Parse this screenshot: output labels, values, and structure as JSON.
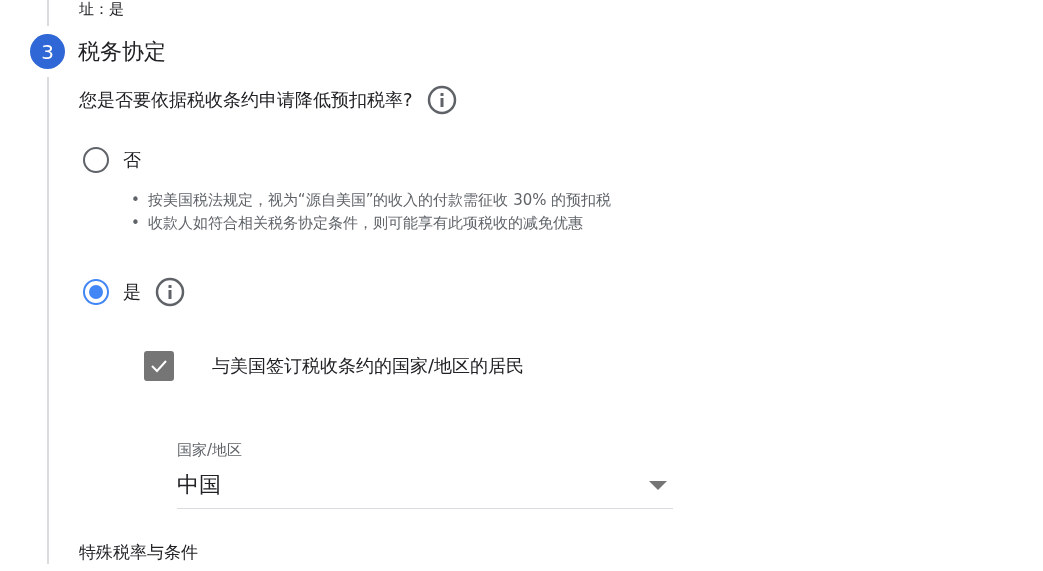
{
  "previous_answer": "址：是",
  "step": {
    "number": "3",
    "title": "税务协定"
  },
  "question": "您是否要依据税收条约申请降低预扣税率?",
  "options": [
    {
      "label": "否",
      "selected": false,
      "info": false,
      "notes": [
        {
          "bullet": "•",
          "text": "按美国税法规定，视为“源自美国”的收入的付款需征收 30% 的预扣税"
        },
        {
          "bullet": "•",
          "text": "收款人如符合相关税务协定条件，则可能享有此项税收的减免优惠"
        }
      ]
    },
    {
      "label": "是",
      "selected": true,
      "info": true
    }
  ],
  "resident_checkbox": {
    "label": "与美国签订税收条约的国家/地区的居民",
    "checked": true
  },
  "country_select": {
    "label": "国家/地区",
    "value": "中国"
  },
  "next_section": "特殊税率与条件"
}
